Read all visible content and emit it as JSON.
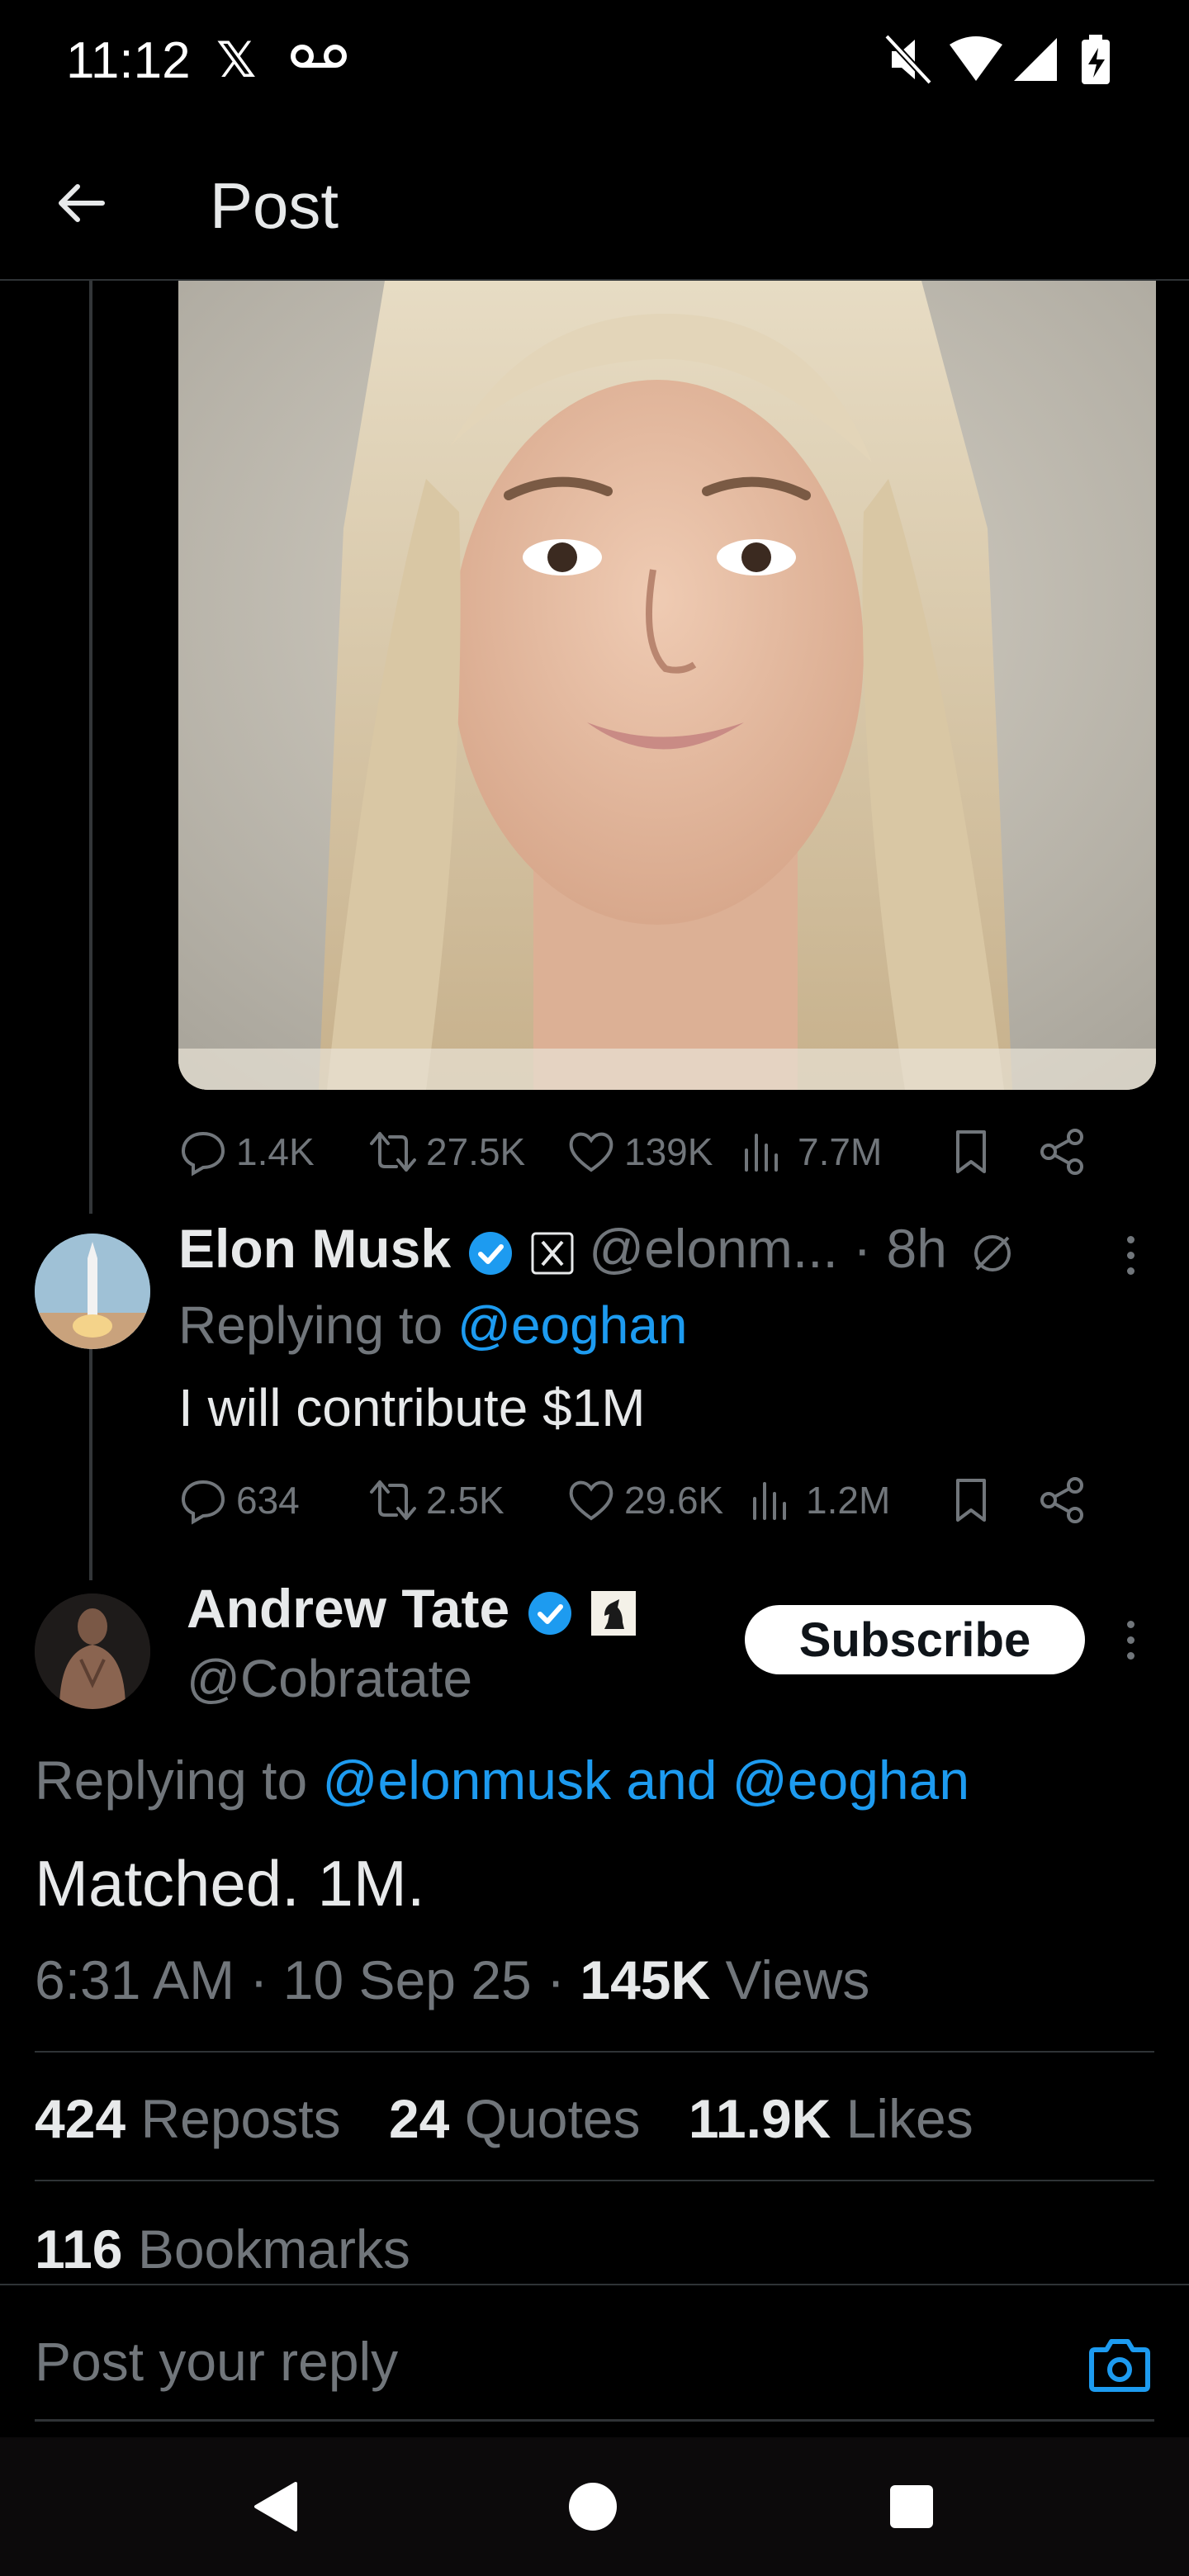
{
  "status": {
    "time": "11:12",
    "x_logo": "𝕏"
  },
  "header": {
    "title": "Post"
  },
  "parent_actions": {
    "replies": "1.4K",
    "reposts": "27.5K",
    "likes": "139K",
    "views": "7.7M"
  },
  "elon_reply": {
    "name": "Elon Musk",
    "handle": "@elonm...",
    "time": "· 8h",
    "replying_prefix": "Replying to ",
    "replying_to": "@eoghan",
    "text": "I will contribute $1M",
    "replies": "634",
    "reposts": "2.5K",
    "likes": "29.6K",
    "views": "1.2M"
  },
  "main_post": {
    "name": "Andrew Tate",
    "handle": "@Cobratate",
    "subscribe_label": "Subscribe",
    "replying_prefix": "Replying to ",
    "replying_to": "@elonmusk and @eoghan",
    "text": "Matched. 1M.",
    "timestamp": "6:31 AM · 10 Sep 25 · ",
    "views_count": "145K",
    "views_label": " Views",
    "reposts_count": "424",
    "reposts_label": " Reposts",
    "quotes_count": "24",
    "quotes_label": " Quotes",
    "likes_count": "11.9K",
    "likes_label": " Likes",
    "bookmarks_count": "116",
    "bookmarks_label": " Bookmarks"
  },
  "reply_box": {
    "placeholder": "Post your reply"
  },
  "colors": {
    "accent": "#1d9bf0",
    "muted": "#71767b",
    "text": "#e7e9ea",
    "background": "#000000"
  }
}
